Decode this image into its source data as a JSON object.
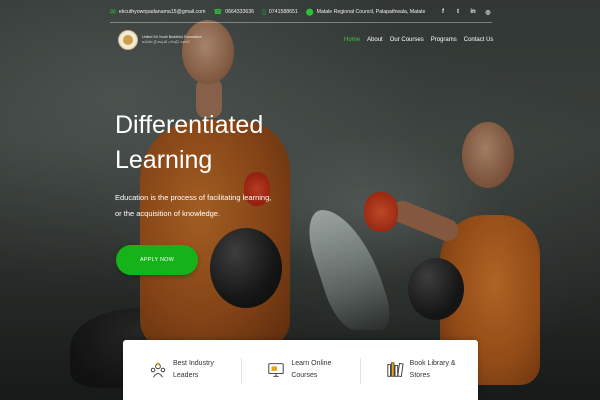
{
  "topbar": {
    "email": "ekcuthyownpadanama15@gmail.com",
    "phone1": "0664333636",
    "phone2": "0741588651",
    "address": "Matale Regional Council, Palapathwala, Matale",
    "email_icon": "envelope-icon",
    "phone1_icon": "phone-icon",
    "phone2_icon": "mobile-icon",
    "address_icon": "map-pin-icon",
    "social_icons": [
      "facebook-icon",
      "twitter-icon",
      "linkedin-icon",
      "instagram-icon"
    ],
    "social_glyphs": [
      "f",
      "t",
      "in",
      "◎"
    ]
  },
  "header": {
    "logo_line1": "United Sri Youth Buddhist Foundation",
    "logo_line2": "සමස්ත ශ්‍රී තරුණ බෞද්ධ පදනම",
    "nav": [
      "Home",
      "About",
      "Our Courses",
      "Programs",
      "Contact Us"
    ],
    "active_nav": "Home"
  },
  "hero": {
    "title_line1": "Differentiated",
    "title_line2": "Learning",
    "subtitle": "Education is the process of facilitating learning, or the acquisition of knowledge.",
    "cta_label": "APPLY NOW"
  },
  "features": [
    {
      "label_line1": "Best Industry",
      "label_line2": "Leaders",
      "icon": "leaders-icon"
    },
    {
      "label_line1": "Learn Online",
      "label_line2": "Courses",
      "icon": "online-course-icon"
    },
    {
      "label_line1": "Book Library &",
      "label_line2": "Stores",
      "icon": "books-icon"
    }
  ],
  "colors": {
    "accent": "#15b219",
    "nav_active": "#3cc845"
  }
}
